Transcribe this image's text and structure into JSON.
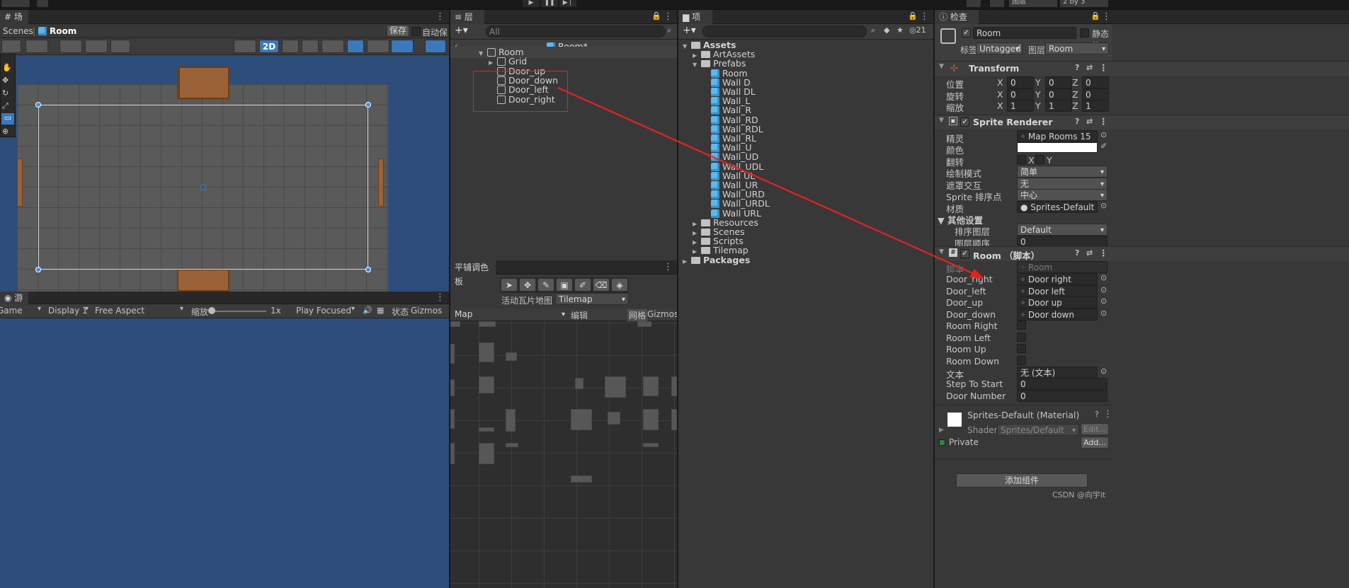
{
  "toolbar_top": {
    "layers_label": "图层",
    "layout_label": "2 by 3"
  },
  "scene": {
    "tab": "场景",
    "breadcrumb_root": "Scenes",
    "breadcrumb_current": "Room",
    "save_label": "保存",
    "autosave_label": "自动保存",
    "mode_2d": "2D"
  },
  "game": {
    "tab": "游戏",
    "view_mode": "Game",
    "display": "Display 1",
    "aspect": "Free Aspect",
    "scale_label": "缩放",
    "scale_value": "1x",
    "play_mode": "Play Focused",
    "stats_label": "状态",
    "gizmos_label": "Gizmos"
  },
  "hierarchy": {
    "tab": "层级",
    "search_placeholder": "All",
    "scene_title": "Room*",
    "items": [
      {
        "label": "Room",
        "depth": 0,
        "arrow": "▼"
      },
      {
        "label": "Grid",
        "depth": 1,
        "arrow": "▶"
      },
      {
        "label": "Door_up",
        "depth": 1,
        "arrow": ""
      },
      {
        "label": "Door_down",
        "depth": 1,
        "arrow": ""
      },
      {
        "label": "Door_left",
        "depth": 1,
        "arrow": ""
      },
      {
        "label": "Door_right",
        "depth": 1,
        "arrow": ""
      }
    ]
  },
  "palette": {
    "tab": "平铺调色板",
    "active_map_label": "活动瓦片地图",
    "active_map_value": "Tilemap",
    "palette_name": "Map",
    "edit_label": "编辑",
    "grid_label": "网格",
    "gizmos_label": "Gizmos"
  },
  "project": {
    "tab": "项目",
    "badge_count": "21",
    "tree": [
      {
        "label": "Assets",
        "depth": 0,
        "kind": "folder",
        "arrow": "▼",
        "bold": true
      },
      {
        "label": "ArtAssets",
        "depth": 1,
        "kind": "folder",
        "arrow": "▶"
      },
      {
        "label": "Prefabs",
        "depth": 1,
        "kind": "folder",
        "arrow": "▼"
      },
      {
        "label": "Room",
        "depth": 2,
        "kind": "prefab"
      },
      {
        "label": "Wall D",
        "depth": 2,
        "kind": "prefab"
      },
      {
        "label": "Wall DL",
        "depth": 2,
        "kind": "prefab"
      },
      {
        "label": "Wall_L",
        "depth": 2,
        "kind": "prefab"
      },
      {
        "label": "Wall_R",
        "depth": 2,
        "kind": "prefab"
      },
      {
        "label": "Wall_RD",
        "depth": 2,
        "kind": "prefab"
      },
      {
        "label": "Wall_RDL",
        "depth": 2,
        "kind": "prefab"
      },
      {
        "label": "Wall_RL",
        "depth": 2,
        "kind": "prefab"
      },
      {
        "label": "Wall_U",
        "depth": 2,
        "kind": "prefab"
      },
      {
        "label": "Wall_UD",
        "depth": 2,
        "kind": "prefab"
      },
      {
        "label": "Wall_UDL",
        "depth": 2,
        "kind": "prefab"
      },
      {
        "label": "Wall UL",
        "depth": 2,
        "kind": "prefab"
      },
      {
        "label": "Wall_UR",
        "depth": 2,
        "kind": "prefab"
      },
      {
        "label": "Wall_URD",
        "depth": 2,
        "kind": "prefab"
      },
      {
        "label": "Wall_URDL",
        "depth": 2,
        "kind": "prefab"
      },
      {
        "label": "Wall URL",
        "depth": 2,
        "kind": "prefab"
      },
      {
        "label": "Resources",
        "depth": 1,
        "kind": "folder",
        "arrow": "▶"
      },
      {
        "label": "Scenes",
        "depth": 1,
        "kind": "folder",
        "arrow": "▶"
      },
      {
        "label": "Scripts",
        "depth": 1,
        "kind": "folder",
        "arrow": "▶"
      },
      {
        "label": "Tilemap",
        "depth": 1,
        "kind": "folder",
        "arrow": "▶"
      },
      {
        "label": "Packages",
        "depth": 0,
        "kind": "folder",
        "arrow": "▶",
        "bold": true
      }
    ]
  },
  "inspector": {
    "tab": "检查器",
    "object_name": "Room",
    "static_label": "静态的",
    "tag_label": "标签",
    "tag_value": "Untagged",
    "layer_label": "图层",
    "layer_value": "Room",
    "transform": {
      "title": "Transform",
      "rows": [
        {
          "label": "位置",
          "x": "0",
          "y": "0",
          "z": "0"
        },
        {
          "label": "旋转",
          "x": "0",
          "y": "0",
          "z": "0"
        },
        {
          "label": "缩放",
          "x": "1",
          "y": "1",
          "z": "1"
        }
      ]
    },
    "sprite_renderer": {
      "title": "Sprite Renderer",
      "sprite_label": "精灵",
      "sprite_value": "Map Rooms 15",
      "color_label": "颜色",
      "color_value": "#ffffff",
      "flip_label": "翻转",
      "flip_x": "X",
      "flip_y": "Y",
      "draw_mode_label": "绘制模式",
      "draw_mode_value": "简单",
      "mask_label": "遮罩交互",
      "mask_value": "无",
      "sort_point_label": "Sprite 排序点",
      "sort_point_value": "中心",
      "material_label": "材质",
      "material_value": "Sprites-Default",
      "additional_label": "其他设置",
      "sorting_layer_label": "排序图层",
      "sorting_layer_value": "Default",
      "order_label": "图层顺序",
      "order_value": "0"
    },
    "room_script": {
      "title": "Room （脚本）",
      "script_label": "脚本",
      "script_value": "Room",
      "refs": [
        {
          "label": "Door_right",
          "value": "Door right"
        },
        {
          "label": "Door_left",
          "value": "Door left"
        },
        {
          "label": "Door_up",
          "value": "Door up"
        },
        {
          "label": "Door_down",
          "value": "Door down"
        }
      ],
      "bools": [
        "Room Right",
        "Room Left",
        "Room Up",
        "Room Down"
      ],
      "text_label": "文本",
      "text_value": "无 (文本)",
      "step_label": "Step To Start",
      "step_value": "0",
      "door_num_label": "Door Number",
      "door_num_value": "0"
    },
    "material": {
      "title": "Sprites-Default (Material)",
      "shader_label": "Shader",
      "shader_value": "Sprites/Default",
      "edit_label": "Edit...",
      "private_label": "Private",
      "add_label": "Add..."
    },
    "add_component_label": "添加组件"
  },
  "watermark": "CSDN @向宇it",
  "colors": {
    "accent": "#3a79bb",
    "arrow": "#e8211f",
    "highlight_box": "#e8211f",
    "scene_bg": "#2d4d7a"
  }
}
